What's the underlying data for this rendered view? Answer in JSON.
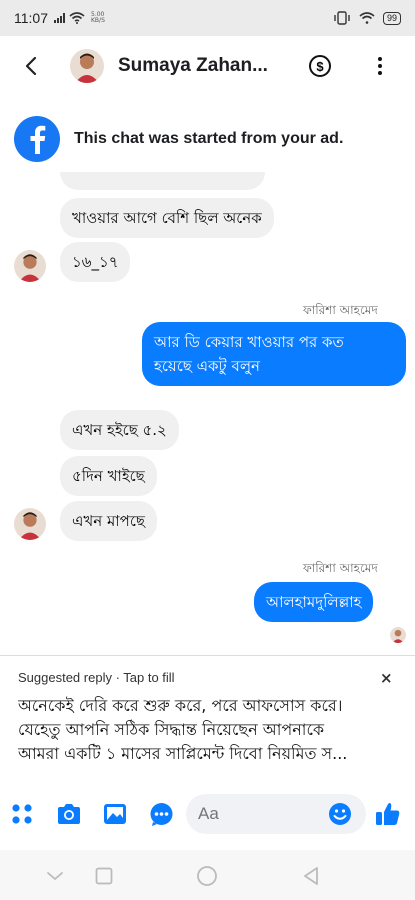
{
  "status_bar": {
    "time": "11:07",
    "speed_value": "5.00",
    "speed_unit": "KB/S",
    "battery": "99"
  },
  "header": {
    "contact_name": "Sumaya Zahan...",
    "dollar_symbol": "$"
  },
  "ad_notice": {
    "text": "This chat was started from your ad."
  },
  "messages": [
    {
      "text": "খাওয়ার আগে বেশি ছিল অনেক"
    },
    {
      "text": "১৬_১৭"
    },
    {
      "sender": "ফারিশা আহমেদ"
    },
    {
      "text_line1": "আর ডি কেয়ার খাওয়ার পর কত",
      "text_line2": "হয়েছে একটু বলুন"
    },
    {
      "text": "এখন হইছে ৫.২"
    },
    {
      "text": "৫দিন খাইছে"
    },
    {
      "text": "এখন মাপছে"
    },
    {
      "sender": "ফারিশা আহমেদ"
    },
    {
      "text": "আলহামদুলিল্লাহ"
    }
  ],
  "suggested_reply": {
    "header": "Suggested reply · Tap to fill",
    "close": "×",
    "lines": [
      "অনেকেই দেরি করে শুরু করে, পরে আফসোস করে।",
      "যেহেতু আপনি সঠিক সিদ্ধান্ত নিয়েছেন আপনাকে",
      "আমরা একটি ১ মাসের সাপ্লিমেন্ট দিবো নিয়মিত স..."
    ]
  },
  "composer": {
    "placeholder": "Aa"
  },
  "colors": {
    "brand_blue": "#0a7cff",
    "facebook_blue": "#1877f2",
    "incoming_bubble": "#f0f0f0"
  }
}
